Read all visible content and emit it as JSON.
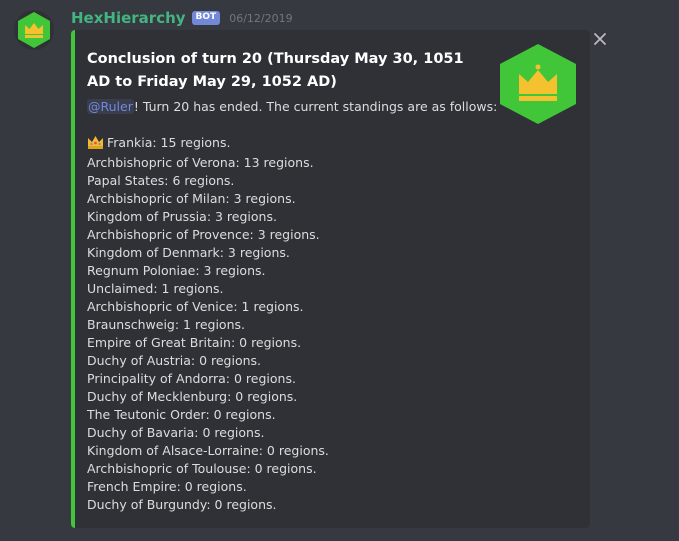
{
  "message": {
    "username": "HexHierarchy",
    "bot_tag": "BOT",
    "timestamp": "06/12/2019",
    "avatar_icon": "crown-hexagon-icon",
    "close_icon": "close-icon",
    "embed_color": "#41c63a"
  },
  "embed": {
    "title": "Conclusion of turn 20 (Thursday May 30, 1051 AD to Friday May 29, 1052 AD)",
    "mention": "@Ruler",
    "intro_rest": "! Turn 20 has ended. The current standings are as follows:",
    "thumbnail_icon": "crown-hexagon-icon",
    "standings": [
      "Frankia: 15 regions.",
      "Archbishopric of Verona: 13 regions.",
      "Papal States: 6 regions.",
      "Archbishopric of Milan: 3 regions.",
      "Kingdom of Prussia: 3 regions.",
      "Archbishopric of Provence: 3 regions.",
      "Kingdom of Denmark: 3 regions.",
      "Regnum Poloniae: 3 regions.",
      "Unclaimed: 1 regions.",
      "Archbishopric of Venice: 1 regions.",
      "Braunschweig: 1 regions.",
      "Empire of Great Britain: 0 regions.",
      "Duchy of Austria: 0 regions.",
      "Principality of Andorra: 0 regions.",
      "Duchy of Mecklenburg: 0 regions.",
      "The Teutonic Order: 0 regions.",
      "Duchy of Bavaria: 0 regions.",
      "Kingdom of Alsace-Lorraine: 0 regions.",
      "Archbishopric of Toulouse: 0 regions.",
      "French Empire: 0 regions.",
      "Duchy of Burgundy: 0 regions."
    ],
    "leader_icon": "crown-emoji-icon"
  }
}
